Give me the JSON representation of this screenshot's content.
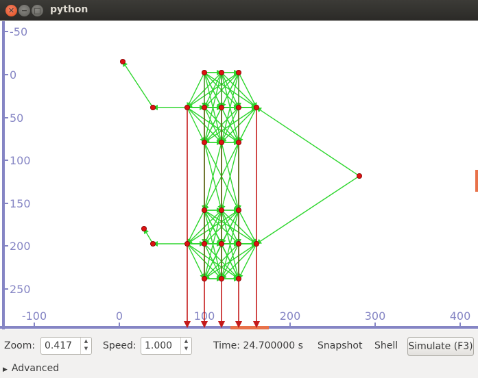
{
  "window": {
    "title": "python"
  },
  "plot": {
    "y_tick_labels": [
      "-50",
      "0",
      "50",
      "100",
      "150",
      "200",
      "250"
    ],
    "x_tick_labels": [
      "-100",
      "0",
      "100",
      "200",
      "300",
      "400"
    ],
    "colors": {
      "axis": "#8585c4",
      "green": "#2ed62e",
      "red": "#c41a1a",
      "node": "#dd1111",
      "accent": "#e8724a"
    }
  },
  "controls": {
    "zoom_label": "Zoom:",
    "zoom_value": "0.417",
    "speed_label": "Speed:",
    "speed_value": "1.000",
    "time_text": "Time: 24.700000 s",
    "snapshot_label": "Snapshot",
    "shell_label": "Shell",
    "simulate_label": "Simulate (F3)",
    "advanced_label": "Advanced"
  }
}
